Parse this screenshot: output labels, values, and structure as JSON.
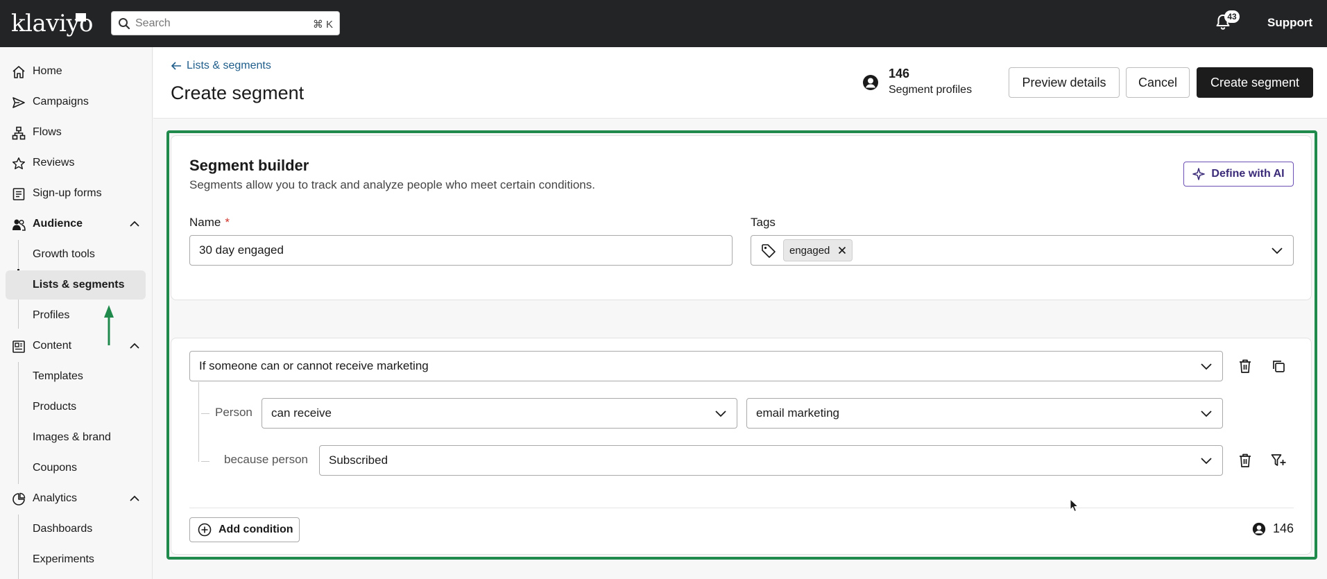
{
  "topbar": {
    "logo": "klaviyo",
    "search_placeholder": "Search",
    "search_shortcut": "⌘ K",
    "notifications_count": "43",
    "support_label": "Support"
  },
  "sidebar": {
    "home": "Home",
    "campaigns": "Campaigns",
    "flows": "Flows",
    "reviews": "Reviews",
    "signup_forms": "Sign-up forms",
    "audience": "Audience",
    "audience_items": [
      "Growth tools",
      "Lists & segments",
      "Profiles"
    ],
    "content": "Content",
    "content_items": [
      "Templates",
      "Products",
      "Images & brand",
      "Coupons"
    ],
    "analytics": "Analytics",
    "analytics_items": [
      "Dashboards",
      "Experiments"
    ]
  },
  "header": {
    "back_label": "Lists & segments",
    "title": "Create segment",
    "profiles_count": "146",
    "profiles_label": "Segment profiles",
    "preview_label": "Preview details",
    "cancel_label": "Cancel",
    "create_label": "Create segment"
  },
  "builder": {
    "title": "Segment builder",
    "subtitle": "Segments allow you to track and analyze people who meet certain conditions.",
    "ai_label": "Define with AI",
    "name_label": "Name",
    "required_mark": "*",
    "name_value": "30 day engaged",
    "tags_label": "Tags",
    "tag_value": "engaged"
  },
  "conditions": {
    "main_select": "If someone can or cannot receive marketing",
    "person_label": "Person",
    "receive_select": "can receive",
    "channel_select": "email marketing",
    "because_label": "because person",
    "reason_select": "Subscribed",
    "add_condition_label": "Add condition",
    "footer_count": "146"
  },
  "colors": {
    "topbar_bg": "#232426",
    "highlight_border": "#1f8a4c",
    "primary_button": "#1c1c1c",
    "link": "#1e5d8a",
    "ai_accent": "#6b4fb3"
  }
}
